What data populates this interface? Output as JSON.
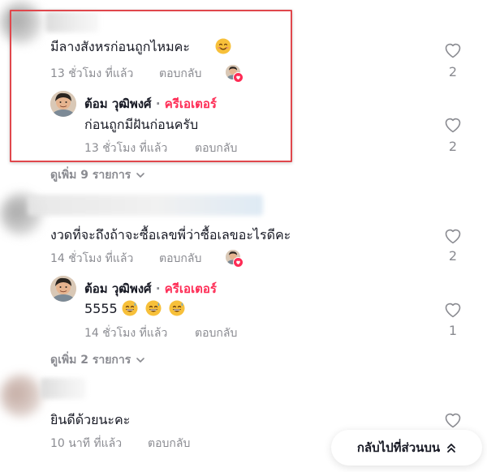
{
  "comments": [
    {
      "text": "มีลางสังหรก่อนถูกไหมคะ",
      "time": "13 ชั่วโมง ที่แล้ว",
      "reply_label": "ตอบกลับ",
      "likes": "2",
      "reply": {
        "author": "ต้อม วุฒิพงศ์",
        "separator": "·",
        "badge": "ครีเอเตอร์",
        "text": "ก่อนถูกมีฝันก่อนครับ",
        "time": "13 ชั่วโมง ที่แล้ว",
        "reply_label": "ตอบกลับ",
        "likes": "2"
      },
      "view_more": "ดูเพิ่ม 9 รายการ"
    },
    {
      "text": "งวดที่จะถึงถ้าจะซื้อเลขพี่ว่าซื้อเลขอะไรดีคะ",
      "time": "14 ชั่วโมง ที่แล้ว",
      "reply_label": "ตอบกลับ",
      "likes": "2",
      "reply": {
        "author": "ต้อม วุฒิพงศ์",
        "separator": "·",
        "badge": "ครีเอเตอร์",
        "text": "5555",
        "time": "14 ชั่วโมง ที่แล้ว",
        "reply_label": "ตอบกลับ",
        "likes": "1"
      },
      "view_more": "ดูเพิ่ม 2 รายการ"
    },
    {
      "text": "ยินดีด้วยนะคะ",
      "time": "10 นาที ที่แล้ว",
      "reply_label": "ตอบกลับ"
    }
  ],
  "back_to_top": "กลับไปที่ส่วนบน",
  "colors": {
    "creator_badge": "#fe2c55",
    "highlight_border": "#e0474c",
    "meta_text": "#8a8b91"
  }
}
